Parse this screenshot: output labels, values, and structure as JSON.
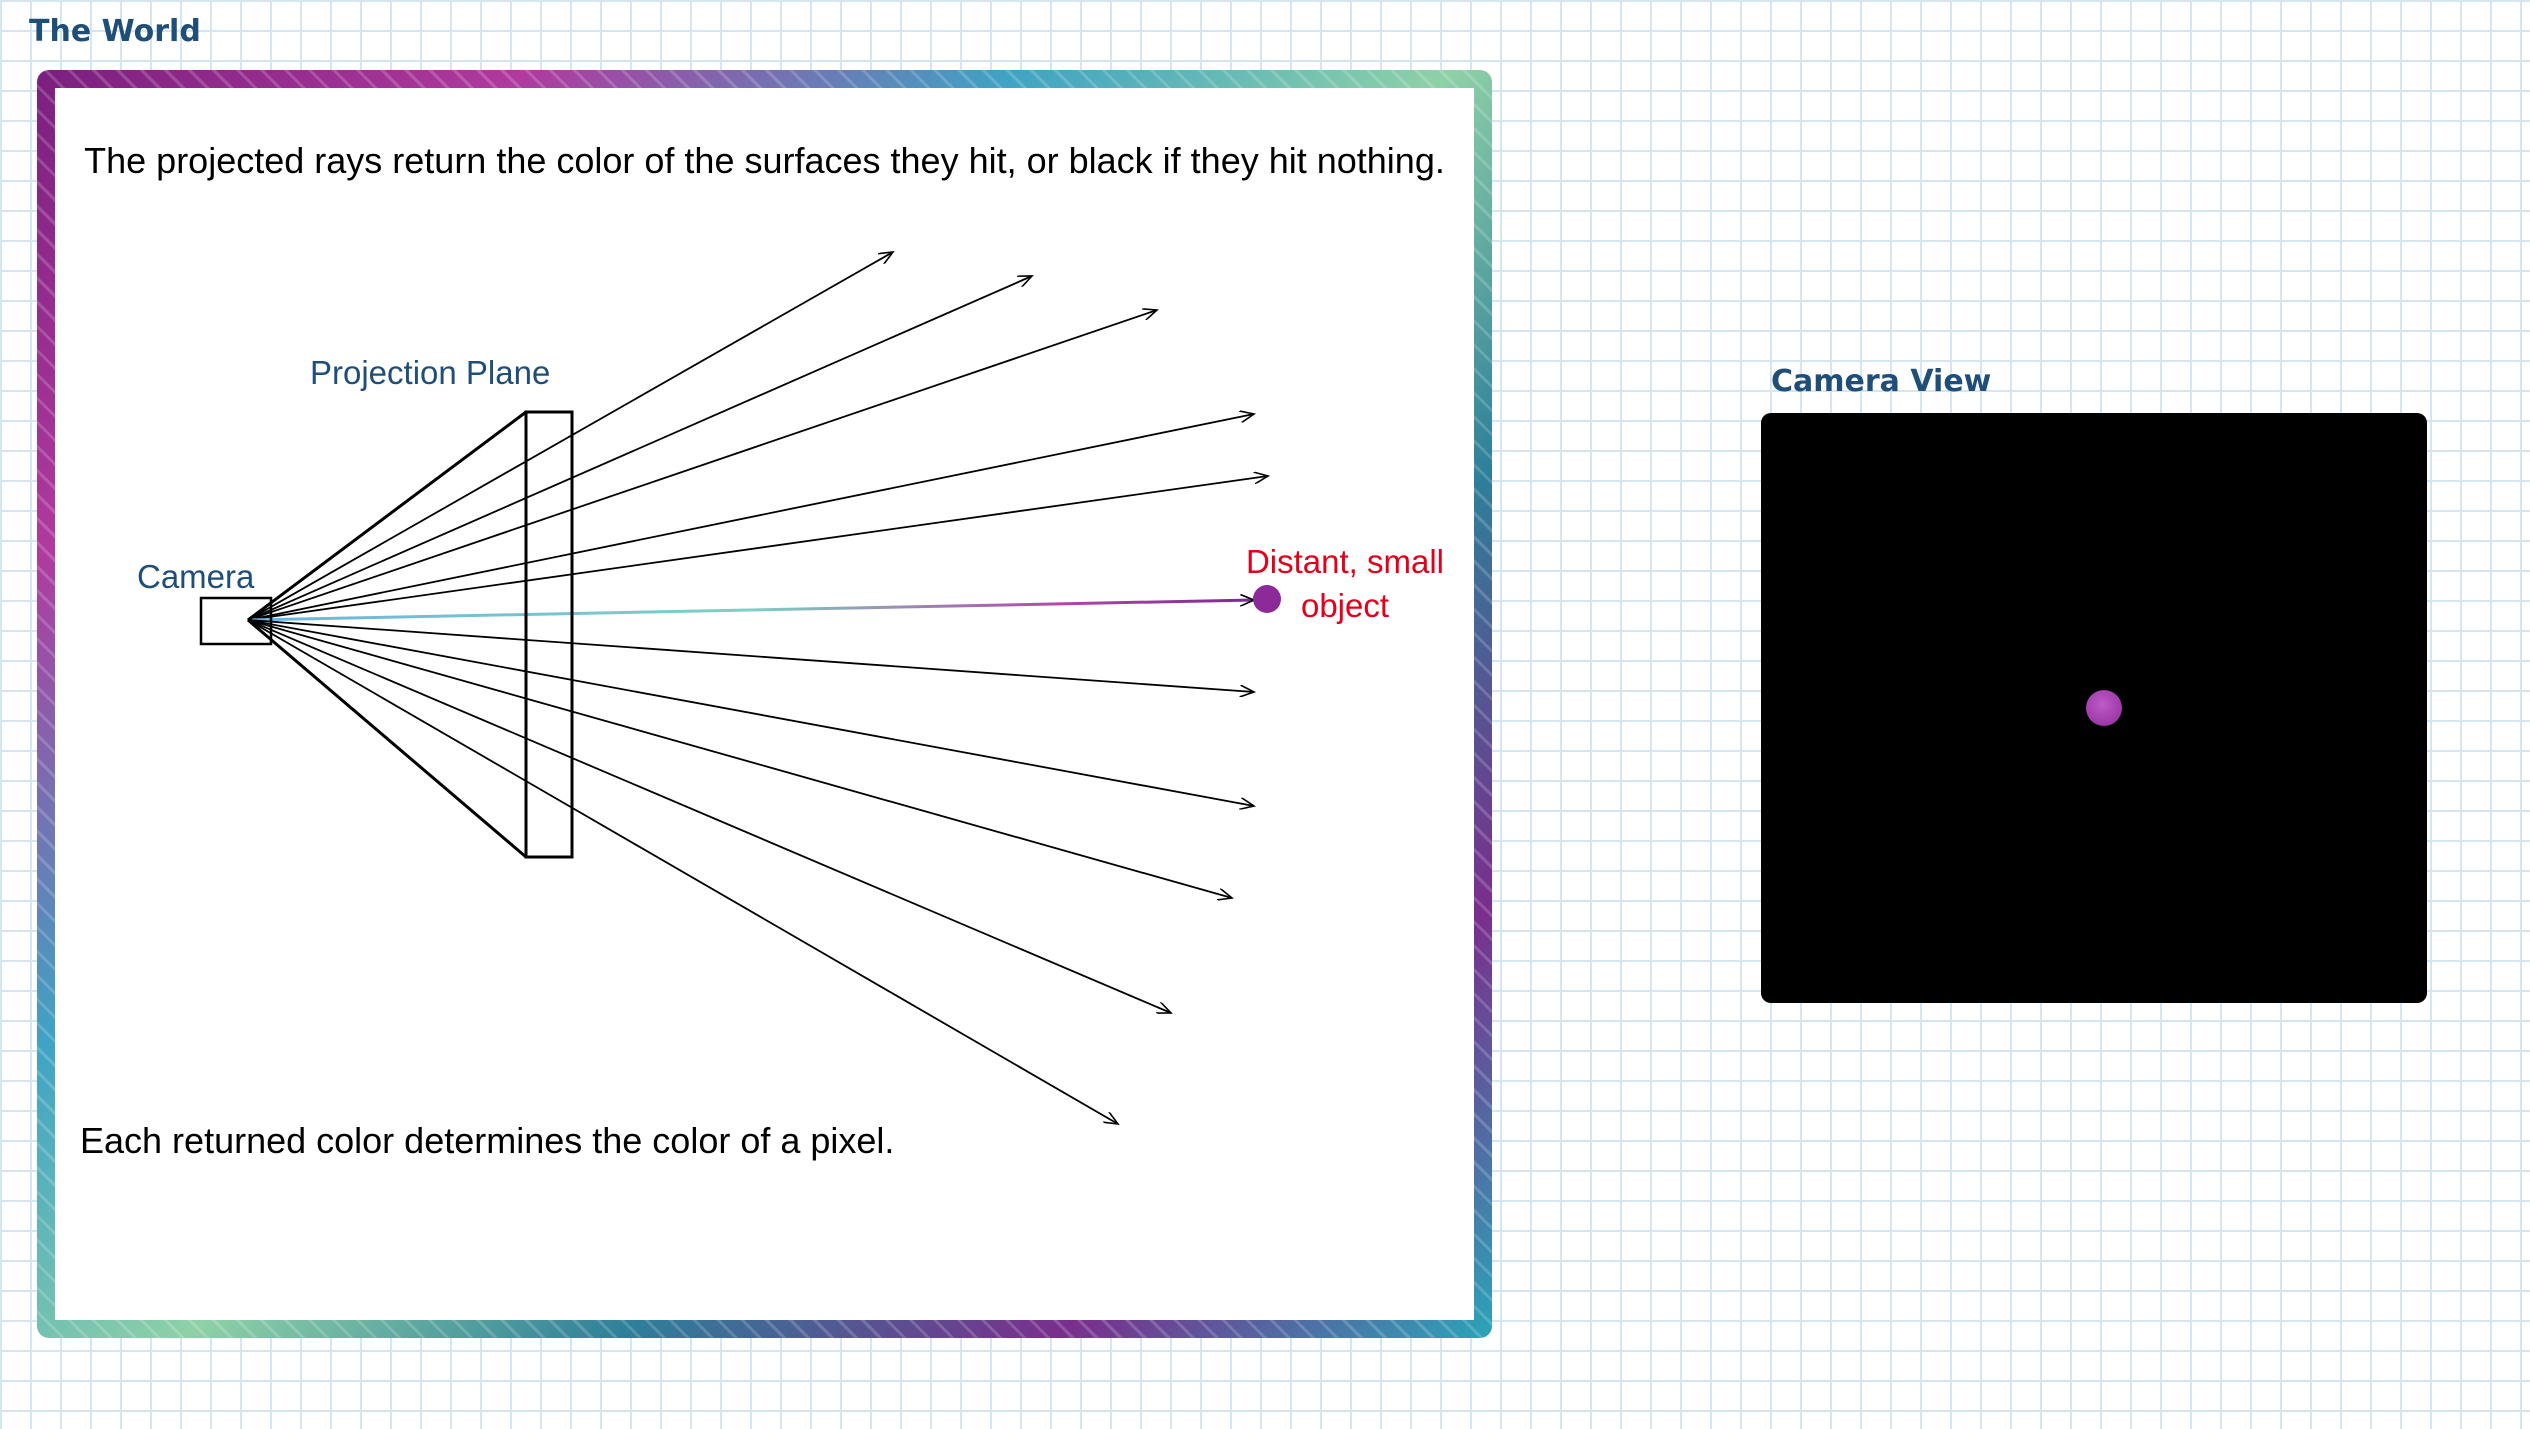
{
  "world_title": "The World",
  "camera_view_title": "Camera View",
  "instruction": "The projected rays return the color of the surfaces they hit, or black if they hit nothing.",
  "caption": "Each returned color determines the color of a pixel.",
  "labels": {
    "projection_plane": "Projection Plane",
    "camera": "Camera",
    "object": "Distant, small object"
  },
  "colors": {
    "title_blue": "#1f4e79",
    "object_label_red": "#e2001a",
    "object_purple": "#8c2a9a",
    "ray": "#000000",
    "view_background": "#000000"
  },
  "rays": {
    "count": 11
  }
}
